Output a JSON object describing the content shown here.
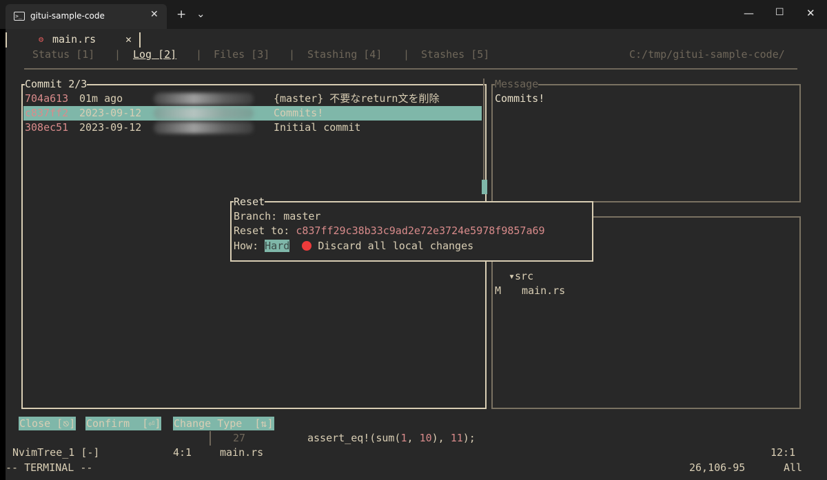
{
  "window": {
    "tab_title": "gitui-sample-code",
    "tab_close": "✕",
    "new_tab": "+",
    "dropdown": "⌄",
    "minimize": "—",
    "maximize": "☐",
    "close": "✕"
  },
  "nvim_tab": {
    "name": "main.rs",
    "close": "✕"
  },
  "gitui": {
    "tabs": [
      "Status [1]",
      "Log [2]",
      "Files [3]",
      "Stashing [4]",
      "Stashes [5]"
    ],
    "active_tab": "Log [2]",
    "separator": "|",
    "path": "C:/tmp/gitui-sample-code/"
  },
  "commit_panel": {
    "title": "Commit 2/3",
    "rows": [
      {
        "hash": "704a613",
        "time": "01m ago",
        "message": "{master} 不要なreturn文を削除"
      },
      {
        "hash": "c837ff2",
        "time": "2023-09-12",
        "message": "Commits!"
      },
      {
        "hash": "308ec51",
        "time": "2023-09-12",
        "message": "Initial commit"
      }
    ],
    "selected_index": 1
  },
  "message_panel": {
    "title": "Message",
    "text": "Commits!"
  },
  "files_panel": {
    "folder": "▾src",
    "file_status": "M",
    "file_name": "main.rs"
  },
  "reset_popup": {
    "title": "Reset",
    "branch_label": "Branch: ",
    "branch": "master",
    "reset_label": "Reset to: ",
    "reset_hash": "c837ff29c38b33c9ad2e72e3724e5978f9857a69",
    "how_label": "How: ",
    "how_value": "Hard",
    "warning": "Discard all local changes"
  },
  "keybar": {
    "close": "Close [⎋]",
    "confirm": "Confirm  [⏎]",
    "change_type": "Change Type  [⇅]"
  },
  "editor": {
    "line_number": "27",
    "code_pre": "assert_eq!(sum(",
    "arg1": "1",
    "comma": ", ",
    "arg2": "10",
    "code_mid": "), ",
    "arg3": "11",
    "code_post": ");"
  },
  "statusline": {
    "left_name": "NvimTree_1 [-]",
    "left_pos": "4:1",
    "file": "main.rs",
    "right_pos": "12:1",
    "mode": "-- TERMINAL --",
    "cursor": "26,106-95",
    "scroll": "All"
  },
  "colors": {
    "accent": "#7fb7a9",
    "fg": "#d9ceb4",
    "hash": "#d98b8b",
    "bg": "#282828"
  }
}
